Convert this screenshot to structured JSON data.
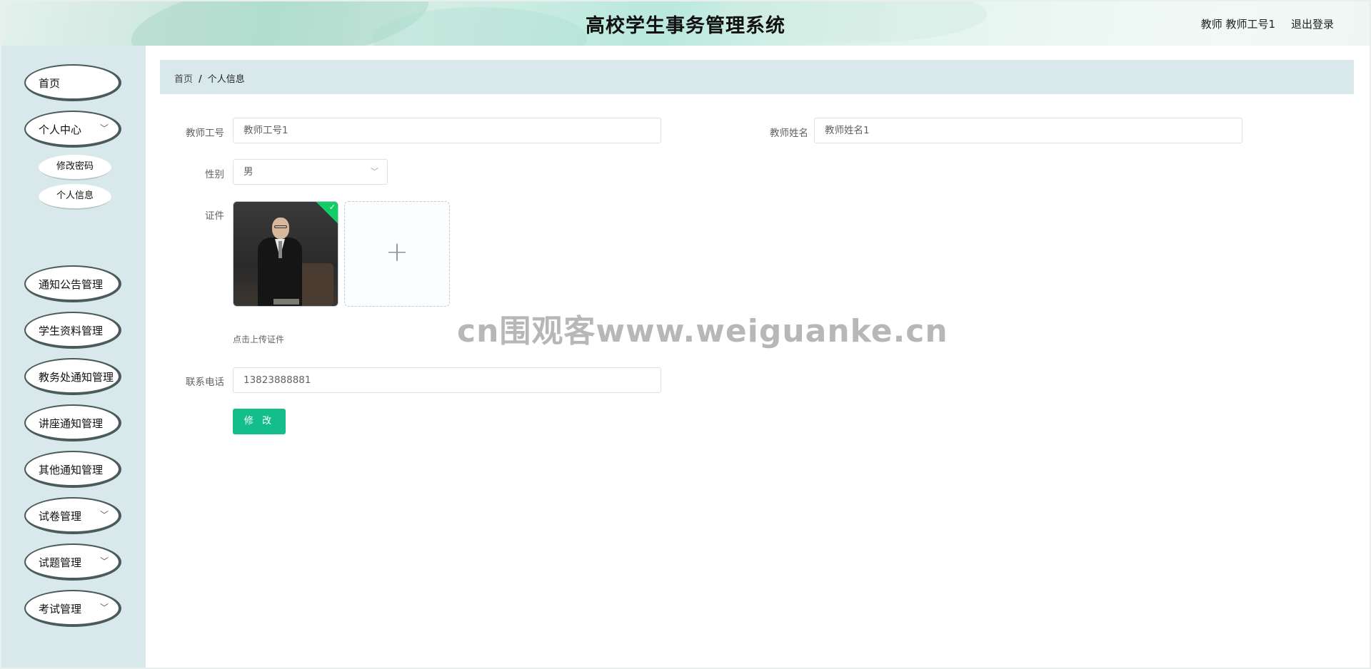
{
  "header": {
    "title": "高校学生事务管理系统",
    "user_info": "教师 教师工号1",
    "logout": "退出登录"
  },
  "sidebar": {
    "items": [
      {
        "label": "首页",
        "has_submenu": false
      },
      {
        "label": "个人中心",
        "has_submenu": true,
        "expanded": true,
        "children": [
          {
            "label": "修改密码"
          },
          {
            "label": "个人信息",
            "active": true
          }
        ]
      },
      {
        "label": "通知公告管理",
        "has_submenu": false
      },
      {
        "label": "学生资料管理",
        "has_submenu": false
      },
      {
        "label": "教务处通知管理",
        "has_submenu": false
      },
      {
        "label": "讲座通知管理",
        "has_submenu": false
      },
      {
        "label": "其他通知管理",
        "has_submenu": false
      },
      {
        "label": "试卷管理",
        "has_submenu": true
      },
      {
        "label": "试题管理",
        "has_submenu": true
      },
      {
        "label": "考试管理",
        "has_submenu": true
      }
    ],
    "chevron_icon": "chevron-down-icon"
  },
  "breadcrumb": {
    "home": "首页",
    "separator": "/",
    "current": "个人信息"
  },
  "form": {
    "teacher_id_label": "教师工号",
    "teacher_id_value": "教师工号1",
    "teacher_name_label": "教师姓名",
    "teacher_name_value": "教师姓名1",
    "gender_label": "性别",
    "gender_value": "男",
    "certificate_label": "证件",
    "upload_hint": "点击上传证件",
    "phone_label": "联系电话",
    "phone_value": "13823888881",
    "submit_label": "修 改"
  },
  "watermark": "cn围观客www.weiguanke.cn",
  "colors": {
    "accent": "#14be8a",
    "sidebar_bg": "#d9e9eb",
    "breadcrumb_bg": "#d9e9eb",
    "menu_border": "#4b5b5c",
    "upload_success": "#13ce66"
  }
}
